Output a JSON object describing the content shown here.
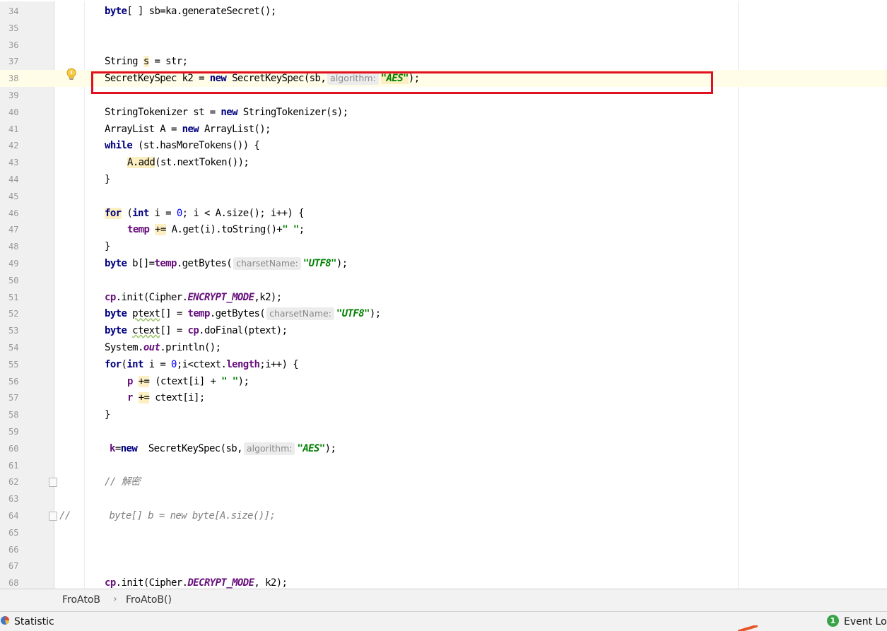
{
  "editor": {
    "lines": [
      {
        "n": "34",
        "indent": 148,
        "seg": [
          {
            "t": "byte",
            "c": "kw"
          },
          {
            "t": "[ ] sb=ka.generateSecret();"
          }
        ]
      },
      {
        "n": "35",
        "indent": 148,
        "seg": []
      },
      {
        "n": "36",
        "indent": 148,
        "seg": []
      },
      {
        "n": "37",
        "indent": 148,
        "seg": [
          {
            "t": "String "
          },
          {
            "t": "s",
            "c": "hl"
          },
          {
            "t": " = str;"
          }
        ]
      },
      {
        "n": "38",
        "indent": 148,
        "caret": true,
        "seg": [
          {
            "t": "SecretKeySpec k2 = "
          },
          {
            "t": "new",
            "c": "kw"
          },
          {
            "t": " SecretKeySpec(sb,"
          },
          {
            "t": "algorithm:",
            "c": "hint"
          },
          {
            "t": "\"AES\"",
            "c": "str hl"
          },
          {
            "t": ");"
          }
        ]
      },
      {
        "n": "39",
        "indent": 148,
        "seg": []
      },
      {
        "n": "40",
        "indent": 148,
        "seg": [
          {
            "t": "StringTokenizer st = "
          },
          {
            "t": "new",
            "c": "kw"
          },
          {
            "t": " StringTokenizer(s);"
          }
        ]
      },
      {
        "n": "41",
        "indent": 148,
        "seg": [
          {
            "t": "ArrayList A = "
          },
          {
            "t": "new",
            "c": "kw"
          },
          {
            "t": " ArrayList();"
          }
        ]
      },
      {
        "n": "42",
        "indent": 148,
        "seg": [
          {
            "t": "while",
            "c": "kw"
          },
          {
            "t": " (st.hasMoreTokens()) {"
          }
        ]
      },
      {
        "n": "43",
        "indent": 180,
        "seg": [
          {
            "t": "A.add",
            "c": "hl"
          },
          {
            "t": "(st.nextToken());"
          }
        ]
      },
      {
        "n": "44",
        "indent": 148,
        "seg": [
          {
            "t": "}"
          }
        ]
      },
      {
        "n": "45",
        "indent": 148,
        "seg": []
      },
      {
        "n": "46",
        "indent": 148,
        "seg": [
          {
            "t": "for",
            "c": "kw hl"
          },
          {
            "t": " ("
          },
          {
            "t": "int",
            "c": "kw"
          },
          {
            "t": " i = "
          },
          {
            "t": "0",
            "c": "num"
          },
          {
            "t": "; i < A.size(); i++) {"
          }
        ]
      },
      {
        "n": "47",
        "indent": 180,
        "seg": [
          {
            "t": "temp",
            "c": "fld"
          },
          {
            "t": " "
          },
          {
            "t": "+=",
            "c": "hl"
          },
          {
            "t": " A.get(i).toString()+"
          },
          {
            "t": "\" \"",
            "c": "str"
          },
          {
            "t": ";"
          }
        ]
      },
      {
        "n": "48",
        "indent": 148,
        "seg": [
          {
            "t": "}"
          }
        ]
      },
      {
        "n": "49",
        "indent": 148,
        "seg": [
          {
            "t": "byte",
            "c": "kw"
          },
          {
            "t": " b[]="
          },
          {
            "t": "temp",
            "c": "fld"
          },
          {
            "t": ".getBytes("
          },
          {
            "t": "charsetName:",
            "c": "hint"
          },
          {
            "t": "\"UTF8\"",
            "c": "str"
          },
          {
            "t": ");"
          }
        ]
      },
      {
        "n": "50",
        "indent": 148,
        "seg": []
      },
      {
        "n": "51",
        "indent": 148,
        "seg": [
          {
            "t": "cp",
            "c": "fld"
          },
          {
            "t": ".init(Cipher."
          },
          {
            "t": "ENCRYPT_MODE",
            "c": "sfld"
          },
          {
            "t": ",k2);"
          }
        ]
      },
      {
        "n": "52",
        "indent": 148,
        "seg": [
          {
            "t": "byte",
            "c": "kw"
          },
          {
            "t": " "
          },
          {
            "t": "ptext",
            "c": "warn"
          },
          {
            "t": "[] = "
          },
          {
            "t": "temp",
            "c": "fld"
          },
          {
            "t": ".getBytes("
          },
          {
            "t": "charsetName:",
            "c": "hint"
          },
          {
            "t": "\"UTF8\"",
            "c": "str"
          },
          {
            "t": ");"
          }
        ]
      },
      {
        "n": "53",
        "indent": 148,
        "seg": [
          {
            "t": "byte",
            "c": "kw"
          },
          {
            "t": " "
          },
          {
            "t": "ctext",
            "c": "warn"
          },
          {
            "t": "[] = "
          },
          {
            "t": "cp",
            "c": "fld"
          },
          {
            "t": ".doFinal(ptext);"
          }
        ]
      },
      {
        "n": "54",
        "indent": 148,
        "seg": [
          {
            "t": "System."
          },
          {
            "t": "out",
            "c": "sfld"
          },
          {
            "t": ".println();"
          }
        ]
      },
      {
        "n": "55",
        "indent": 148,
        "seg": [
          {
            "t": "for",
            "c": "kw"
          },
          {
            "t": "("
          },
          {
            "t": "int",
            "c": "kw"
          },
          {
            "t": " i = "
          },
          {
            "t": "0",
            "c": "num"
          },
          {
            "t": ";i<ctext."
          },
          {
            "t": "length",
            "c": "fld"
          },
          {
            "t": ";i++) {"
          }
        ]
      },
      {
        "n": "56",
        "indent": 180,
        "seg": [
          {
            "t": "p",
            "c": "fld"
          },
          {
            "t": " "
          },
          {
            "t": "+=",
            "c": "hl"
          },
          {
            "t": " (ctext[i] + "
          },
          {
            "t": "\" \"",
            "c": "str"
          },
          {
            "t": ");"
          }
        ]
      },
      {
        "n": "57",
        "indent": 180,
        "seg": [
          {
            "t": "r",
            "c": "fld"
          },
          {
            "t": " "
          },
          {
            "t": "+=",
            "c": "hl"
          },
          {
            "t": " ctext[i];"
          }
        ]
      },
      {
        "n": "58",
        "indent": 148,
        "seg": [
          {
            "t": "}"
          }
        ]
      },
      {
        "n": "59",
        "indent": 148,
        "seg": []
      },
      {
        "n": "60",
        "indent": 155,
        "seg": [
          {
            "t": "k",
            "c": "fld"
          },
          {
            "t": "="
          },
          {
            "t": "new",
            "c": "kw"
          },
          {
            "t": "  SecretKeySpec(sb,"
          },
          {
            "t": "algorithm:",
            "c": "hint"
          },
          {
            "t": "\"AES\"",
            "c": "str"
          },
          {
            "t": ");"
          }
        ]
      },
      {
        "n": "61",
        "indent": 148,
        "seg": []
      },
      {
        "n": "62",
        "indent": 148,
        "fold": "start",
        "seg": [
          {
            "t": "// 解密",
            "c": "cmt"
          }
        ]
      },
      {
        "n": "63",
        "indent": 148,
        "seg": []
      },
      {
        "n": "64",
        "indent": 84,
        "fold": "end",
        "seg": [
          {
            "t": "//       byte[] b = new byte[A.size()];",
            "c": "cmt"
          }
        ]
      },
      {
        "n": "65",
        "indent": 148,
        "seg": []
      },
      {
        "n": "66",
        "indent": 148,
        "seg": []
      },
      {
        "n": "67",
        "indent": 148,
        "seg": []
      },
      {
        "n": "68",
        "indent": 148,
        "seg": [
          {
            "t": "cp",
            "c": "fld"
          },
          {
            "t": ".init(Cipher."
          },
          {
            "t": "DECRYPT_MODE",
            "c": "sfld"
          },
          {
            "t": ", k2);"
          }
        ]
      }
    ]
  },
  "breadcrumb": {
    "items": [
      "FroAtoB",
      "FroAtoB()"
    ],
    "separator": "›"
  },
  "statusbar": {
    "left_text": "Statistic",
    "event_count": "1",
    "event_label": "Event Log"
  },
  "colors": {
    "highlight_box": "#e0101e",
    "keyword": "#000080",
    "string": "#008000",
    "field": "#660e7a"
  },
  "icons": {
    "gutter_intention": "lightbulb-icon",
    "status_left": "statistic-icon",
    "fold_markers": "fold-icon"
  }
}
